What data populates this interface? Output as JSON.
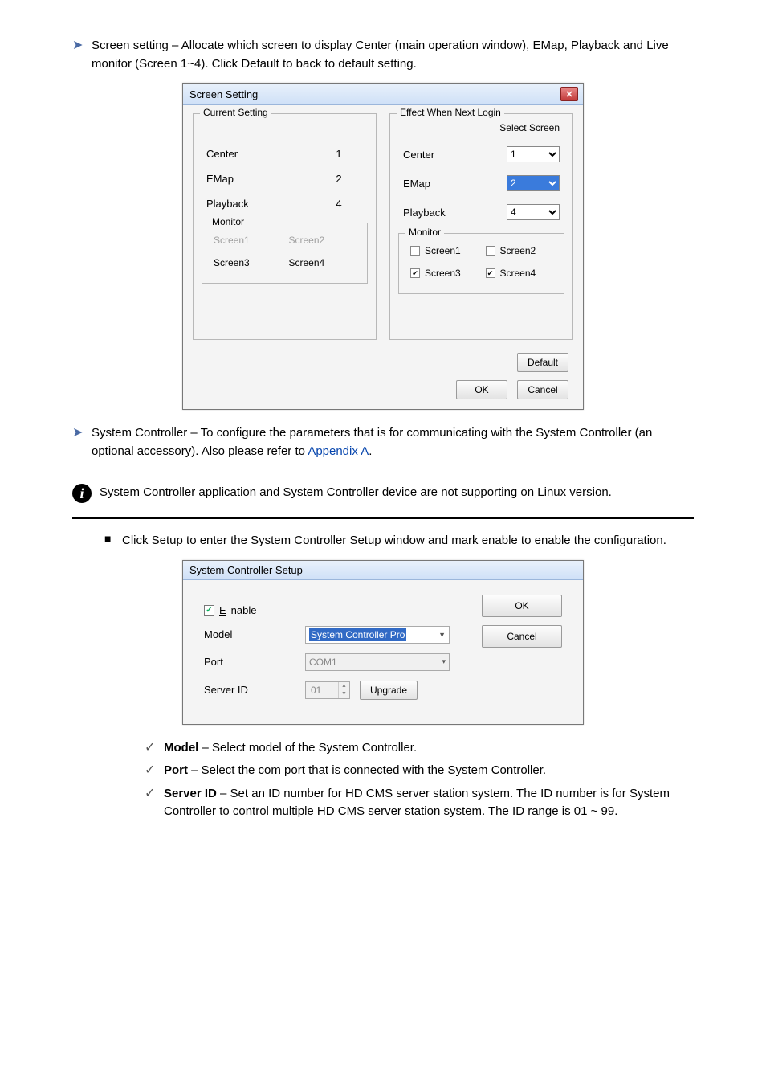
{
  "intro": {
    "bullet1": "Screen setting – Allocate which screen to display Center (main operation window), EMap, Playback and Live monitor (Screen 1~4). Click Default to back to default setting."
  },
  "screen_dialog": {
    "title": "Screen Setting",
    "current_setting_legend": "Current Setting",
    "effect_legend": "Effect When Next Login",
    "select_screen_header": "Select Screen",
    "rows": [
      {
        "label": "Center",
        "value": "1",
        "select": "1"
      },
      {
        "label": "EMap",
        "value": "2",
        "select": "2"
      },
      {
        "label": "Playback",
        "value": "4",
        "select": "4"
      }
    ],
    "monitor_legend": "Monitor",
    "monitors_left": [
      {
        "label": "Screen1",
        "disabled": true
      },
      {
        "label": "Screen2",
        "disabled": true
      },
      {
        "label": "Screen3",
        "disabled": false
      },
      {
        "label": "Screen4",
        "disabled": false
      }
    ],
    "monitors_right": [
      {
        "label": "Screen1",
        "checked": false
      },
      {
        "label": "Screen2",
        "checked": false
      },
      {
        "label": "Screen3",
        "checked": true
      },
      {
        "label": "Screen4",
        "checked": true
      }
    ],
    "default_btn": "Default",
    "ok": "OK",
    "cancel": "Cancel"
  },
  "text_after_screen": {
    "line_prefix": "System Controller – To configure the parameters that is for communicating with the System Controller (an optional accessory). Also please refer to ",
    "link_text": "Appendix A",
    "line_suffix": "."
  },
  "note_text": "System Controller application and System Controller device are not supporting on Linux version.",
  "controller_intro": "Click Setup to enter the System Controller Setup window and mark enable to enable the configuration.",
  "controller_dialog": {
    "title": "System Controller Setup",
    "enable_label": "Enable",
    "enable_checked": true,
    "model_label": "Model",
    "model_value": "System Controller Pro",
    "port_label": "Port",
    "port_value": "COM1",
    "serverid_label": "Server ID",
    "serverid_value": "01",
    "upgrade_btn": "Upgrade",
    "ok": "OK",
    "cancel": "Cancel"
  },
  "checks": {
    "c1_label": "Model",
    "c1_text": " – Select model of the System Controller.",
    "c2_label": "Port",
    "c2_text": " – Select the com port that is connected with the System Controller.",
    "c3_label": "Server ID",
    "c3_text": " – Set an ID number for HD CMS server station system. The ID number is for System Controller to control multiple HD CMS server station system. The ID range is 01 ~ 99."
  }
}
